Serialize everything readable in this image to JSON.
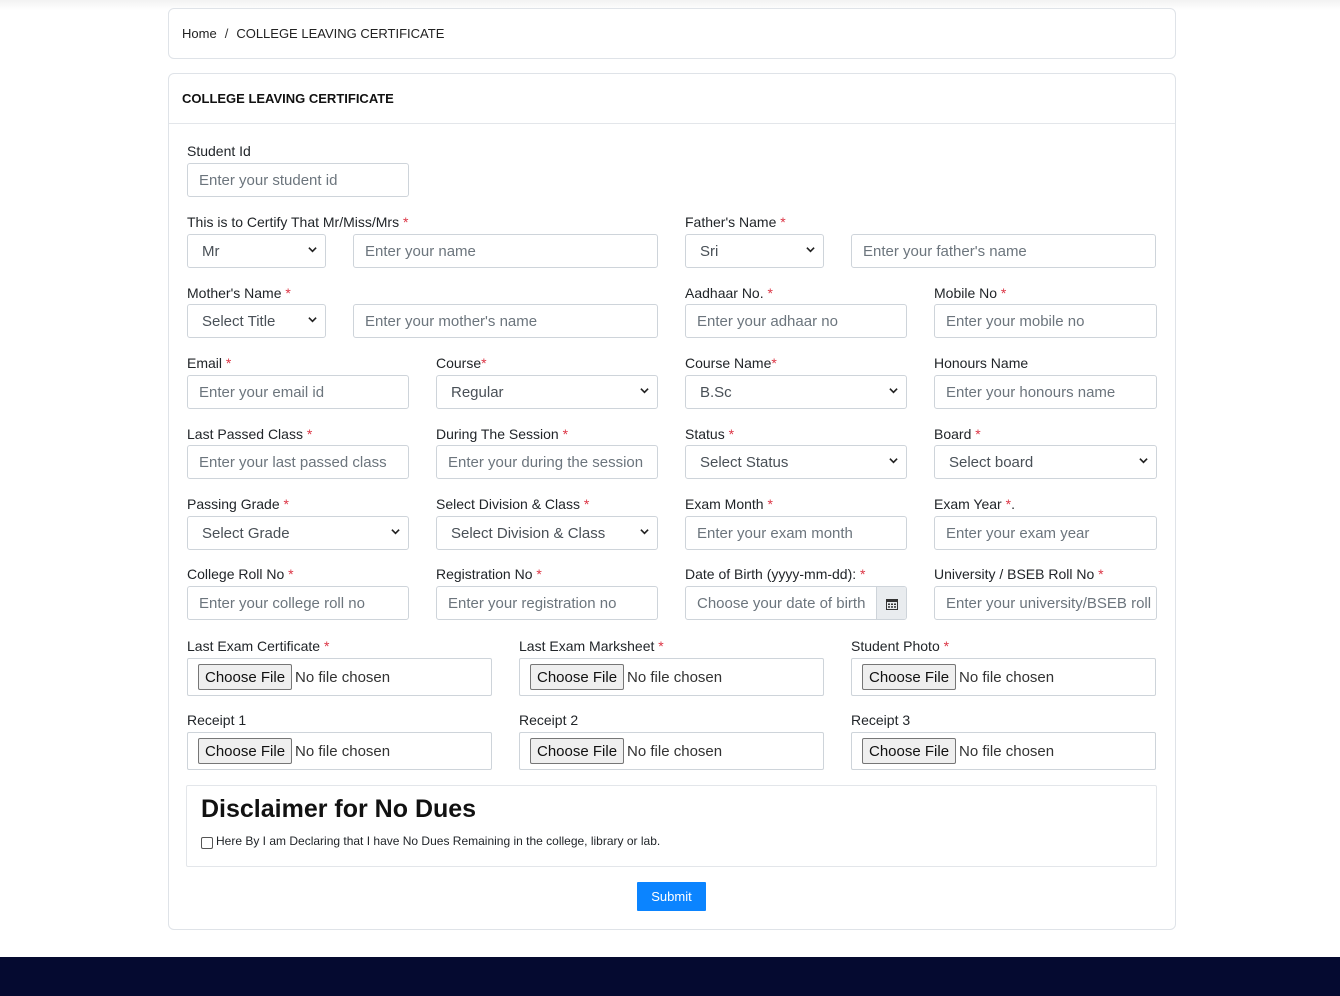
{
  "breadcrumb": {
    "home": "Home",
    "separator": "/",
    "current": "COLLEGE LEAVING CERTIFICATE"
  },
  "header": {
    "title": "COLLEGE LEAVING CERTIFICATE"
  },
  "form": {
    "student_id": {
      "label": "Student Id",
      "placeholder": "Enter your student id"
    },
    "certify": {
      "label": "This is to Certify That Mr/Miss/Mrs",
      "title_value": "Mr",
      "placeholder": "Enter your name"
    },
    "father": {
      "label": "Father's Name",
      "title_value": "Sri",
      "placeholder": "Enter your father's name"
    },
    "mother": {
      "label": "Mother's Name",
      "title_value": "Select Title",
      "placeholder": "Enter your mother's name"
    },
    "aadhaar": {
      "label": "Aadhaar No.",
      "placeholder": "Enter your adhaar no"
    },
    "mobile": {
      "label": "Mobile No",
      "placeholder": "Enter your mobile no"
    },
    "email": {
      "label": "Email",
      "placeholder": "Enter your email id"
    },
    "course": {
      "label": "Course",
      "value": "Regular"
    },
    "course_name": {
      "label": "Course Name",
      "value": "B.Sc"
    },
    "honours": {
      "label": "Honours Name",
      "placeholder": "Enter your honours name"
    },
    "last_class": {
      "label": "Last Passed Class",
      "placeholder": "Enter your last passed class"
    },
    "session": {
      "label": "During The Session",
      "placeholder": "Enter your during the session"
    },
    "status": {
      "label": "Status",
      "value": "Select Status"
    },
    "board": {
      "label": "Board",
      "value": "Select board"
    },
    "grade": {
      "label": "Passing Grade",
      "value": "Select Grade"
    },
    "division": {
      "label": "Select Division & Class",
      "value": "Select Division & Class"
    },
    "exam_month": {
      "label": "Exam Month",
      "placeholder": "Enter your exam month"
    },
    "exam_year": {
      "label": "Exam Year",
      "suffix": ".",
      "placeholder": "Enter your exam year"
    },
    "roll": {
      "label": "College Roll No",
      "placeholder": "Enter your college roll no"
    },
    "registration": {
      "label": "Registration No",
      "placeholder": "Enter your registration no"
    },
    "dob": {
      "label": "Date of Birth (yyyy-mm-dd):",
      "placeholder": "Choose your date of birth"
    },
    "university": {
      "label": "University / BSEB Roll No",
      "placeholder": "Enter your university/BSEB roll no"
    },
    "required_mark": "*",
    "files": {
      "choose_label": "Choose File",
      "status": "No file chosen",
      "last_cert": "Last Exam Certificate",
      "last_marksheet": "Last Exam Marksheet",
      "photo": "Student Photo",
      "receipt1": "Receipt 1",
      "receipt2": "Receipt 2",
      "receipt3": "Receipt 3"
    },
    "disclaimer": {
      "title": "Disclaimer for No Dues",
      "checkbox_label": "Here By I am Declaring that I have No Dues Remaining in the college, library or lab."
    },
    "submit_label": "Submit"
  },
  "colors": {
    "primary": "#0b84ff",
    "required": "#dc3545",
    "footer": "#050a30"
  },
  "icons": {
    "select": "chevron-down-icon",
    "calendar": "calendar-icon"
  }
}
